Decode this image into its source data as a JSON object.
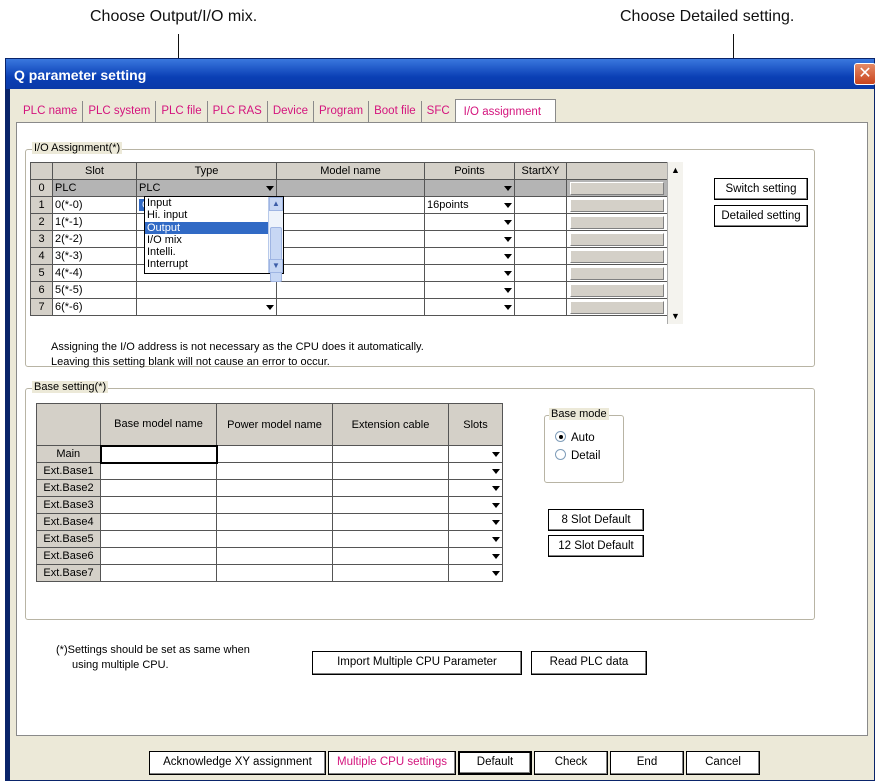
{
  "callouts": {
    "left": "Choose Output/I/O mix.",
    "right": "Choose Detailed setting."
  },
  "window": {
    "title": "Q parameter setting",
    "close_glyph": "✕"
  },
  "tabs": [
    {
      "label": "PLC name"
    },
    {
      "label": "PLC system"
    },
    {
      "label": "PLC file"
    },
    {
      "label": "PLC RAS"
    },
    {
      "label": "Device"
    },
    {
      "label": "Program"
    },
    {
      "label": "Boot file"
    },
    {
      "label": "SFC"
    },
    {
      "label": "I/O assignment"
    }
  ],
  "io_assignment": {
    "legend": "I/O Assignment(*)",
    "columns": [
      "Slot",
      "Type",
      "Model name",
      "Points",
      "StartXY"
    ],
    "rows": [
      {
        "no": "0",
        "slot": "PLC",
        "type": "PLC",
        "model": "",
        "points": "",
        "start": ""
      },
      {
        "no": "1",
        "slot": "0(*-0)",
        "type": "Output",
        "model": "",
        "points": "16points",
        "start": ""
      },
      {
        "no": "2",
        "slot": "1(*-1)",
        "type": "",
        "model": "",
        "points": "",
        "start": ""
      },
      {
        "no": "3",
        "slot": "2(*-2)",
        "type": "",
        "model": "",
        "points": "",
        "start": ""
      },
      {
        "no": "4",
        "slot": "3(*-3)",
        "type": "",
        "model": "",
        "points": "",
        "start": ""
      },
      {
        "no": "5",
        "slot": "4(*-4)",
        "type": "",
        "model": "",
        "points": "",
        "start": ""
      },
      {
        "no": "6",
        "slot": "5(*-5)",
        "type": "",
        "model": "",
        "points": "",
        "start": ""
      },
      {
        "no": "7",
        "slot": "6(*-6)",
        "type": "",
        "model": "",
        "points": "",
        "start": ""
      }
    ],
    "type_options": [
      "Input",
      "Hi. input",
      "Output",
      "I/O mix",
      "Intelli.",
      "Interrupt"
    ],
    "type_selected": "Output",
    "switch_setting": "Switch setting",
    "detailed_setting": "Detailed setting",
    "note_line1": "Assigning the I/O address is not necessary as the CPU does it automatically.",
    "note_line2": "Leaving this setting blank will not cause an error to occur."
  },
  "base_setting": {
    "legend": "Base setting(*)",
    "columns": [
      "Base model name",
      "Power model name",
      "Extension cable",
      "Slots"
    ],
    "rows": [
      "Main",
      "Ext.Base1",
      "Ext.Base2",
      "Ext.Base3",
      "Ext.Base4",
      "Ext.Base5",
      "Ext.Base6",
      "Ext.Base7"
    ],
    "base_mode": {
      "label": "Base mode",
      "auto": "Auto",
      "detail": "Detail",
      "selected": "Auto"
    },
    "slot8": "8 Slot Default",
    "slot12": "12 Slot Default"
  },
  "multi_cpu": {
    "note_line1": "(*)Settings should be set as same when",
    "note_line2": "using multiple CPU.",
    "import_btn": "Import Multiple CPU Parameter",
    "read_btn": "Read PLC data"
  },
  "footer": {
    "ack": "Acknowledge XY assignment",
    "multi": "Multiple CPU settings",
    "default": "Default",
    "check": "Check",
    "end": "End",
    "cancel": "Cancel"
  }
}
